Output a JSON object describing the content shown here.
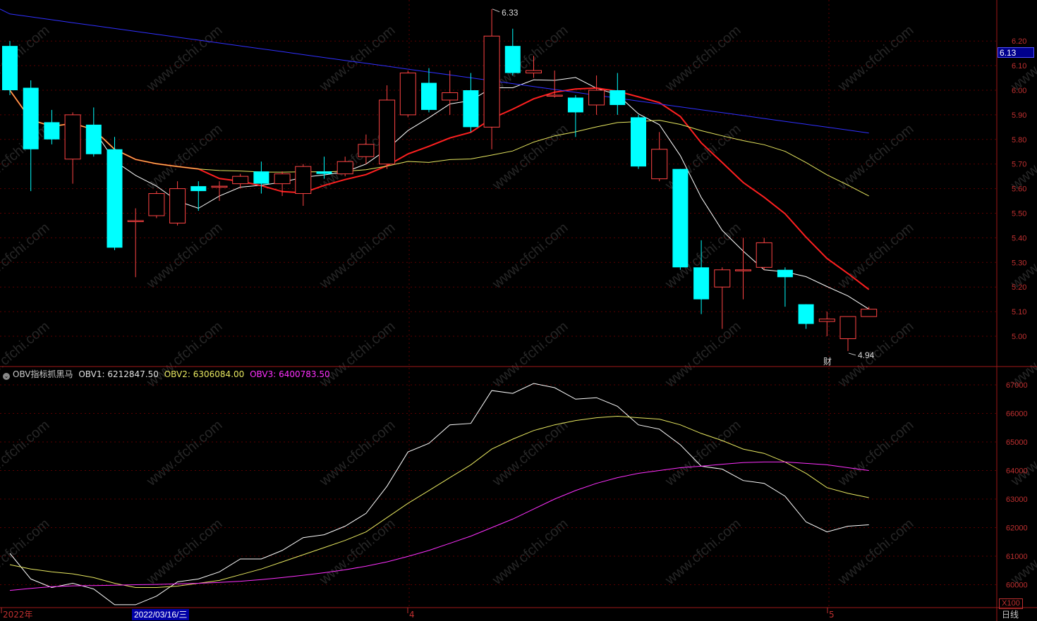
{
  "price_axis": {
    "ticks": [
      "6.20",
      "6.10",
      "6.00",
      "5.90",
      "5.80",
      "5.70",
      "5.60",
      "5.50",
      "5.40",
      "5.30",
      "5.20",
      "5.10",
      "5.00"
    ],
    "current": "6.13"
  },
  "annotations": {
    "high": "6.33",
    "low": "4.94",
    "fin_marker": "财"
  },
  "indicator": {
    "name": "OBV指标抓黑马",
    "obv1_label": "OBV1: 6212847.50",
    "obv2_label": "OBV2: 6306084.00",
    "obv3_label": "OBV3: 6400783.50",
    "ticks": [
      "67000",
      "66000",
      "65000",
      "64000",
      "63000",
      "62000",
      "61000",
      "60000"
    ],
    "scale": "X100"
  },
  "x_axis": {
    "labels": [
      "2022年",
      "4",
      "5"
    ],
    "cursor_date": "2022/03/16/三"
  },
  "period_button": "日线",
  "watermark": "www.cfchi.com",
  "colors": {
    "up": "#ff4444",
    "down": "#00ffff",
    "ma5": "#ffffff",
    "ma10": "#ff2020",
    "ma20": "#e8e860",
    "ma60": "#3030ff",
    "obv1": "#ffffff",
    "obv2": "#e8e860",
    "obv3": "#ff30ff"
  },
  "chart_data": [
    {
      "type": "candlestick",
      "ylim": [
        4.88,
        6.4
      ],
      "candles": [
        [
          6.18,
          6.0,
          6.2,
          5.98
        ],
        [
          6.01,
          5.76,
          6.04,
          5.59
        ],
        [
          5.87,
          5.8,
          5.92,
          5.78
        ],
        [
          5.72,
          5.9,
          5.91,
          5.62
        ],
        [
          5.86,
          5.74,
          5.93,
          5.73
        ],
        [
          5.76,
          5.36,
          5.81,
          5.35
        ],
        [
          5.47,
          5.47,
          5.52,
          5.24
        ],
        [
          5.49,
          5.58,
          5.59,
          5.48
        ],
        [
          5.46,
          5.6,
          5.63,
          5.45
        ],
        [
          5.61,
          5.59,
          5.63,
          5.51
        ],
        [
          5.61,
          5.61,
          5.63,
          5.55
        ],
        [
          5.62,
          5.65,
          5.66,
          5.6
        ],
        [
          5.67,
          5.62,
          5.71,
          5.58
        ],
        [
          5.62,
          5.66,
          5.67,
          5.57
        ],
        [
          5.58,
          5.69,
          5.7,
          5.53
        ],
        [
          5.67,
          5.66,
          5.73,
          5.64
        ],
        [
          5.66,
          5.71,
          5.73,
          5.65
        ],
        [
          5.73,
          5.78,
          5.82,
          5.7
        ],
        [
          5.7,
          5.96,
          6.02,
          5.68
        ],
        [
          5.9,
          6.07,
          6.08,
          5.89
        ],
        [
          6.03,
          5.92,
          6.09,
          5.91
        ],
        [
          5.96,
          5.99,
          6.08,
          5.9
        ],
        [
          6.0,
          5.85,
          6.07,
          5.83
        ],
        [
          5.85,
          6.22,
          6.33,
          5.76
        ],
        [
          6.18,
          6.07,
          6.25,
          6.06
        ],
        [
          6.07,
          6.08,
          6.14,
          6.05
        ],
        [
          5.98,
          5.98,
          6.08,
          5.97
        ],
        [
          5.97,
          5.91,
          5.98,
          5.81
        ],
        [
          5.94,
          6.0,
          6.06,
          5.9
        ],
        [
          6.0,
          5.94,
          6.07,
          5.9
        ],
        [
          5.89,
          5.69,
          5.9,
          5.68
        ],
        [
          5.64,
          5.76,
          5.83,
          5.63
        ],
        [
          5.68,
          5.28,
          5.68,
          5.27
        ],
        [
          5.28,
          5.15,
          5.39,
          5.09
        ],
        [
          5.2,
          5.27,
          5.28,
          5.03
        ],
        [
          5.27,
          5.27,
          5.4,
          5.15
        ],
        [
          5.28,
          5.38,
          5.4,
          5.27
        ],
        [
          5.27,
          5.24,
          5.28,
          5.12
        ],
        [
          5.13,
          5.05,
          5.13,
          5.03
        ],
        [
          5.06,
          5.07,
          5.1,
          5.0
        ],
        [
          4.99,
          5.08,
          5.08,
          4.94
        ],
        [
          5.08,
          5.11,
          5.12,
          5.08
        ]
      ]
    },
    {
      "type": "line",
      "series": [
        {
          "name": "OBV1",
          "values": [
            61100,
            60200,
            59900,
            60050,
            59850,
            59300,
            59300,
            59600,
            60100,
            60200,
            60450,
            60900,
            60900,
            61200,
            61650,
            61750,
            62050,
            62500,
            63450,
            64650,
            64950,
            65600,
            65650,
            66800,
            66700,
            67050,
            66900,
            66500,
            66550,
            66250,
            65600,
            65450,
            64900,
            64150,
            64050,
            63650,
            63550,
            63100,
            62200,
            61850,
            62050,
            62100
          ]
        },
        {
          "name": "OBV2",
          "values": [
            60700,
            60550,
            60450,
            60380,
            60250,
            60050,
            59900,
            59900,
            59950,
            60050,
            60150,
            60350,
            60550,
            60800,
            61050,
            61300,
            61550,
            61850,
            62350,
            62850,
            63300,
            63750,
            64200,
            64750,
            65100,
            65400,
            65600,
            65750,
            65850,
            65900,
            65850,
            65800,
            65600,
            65300,
            65050,
            64750,
            64600,
            64300,
            63900,
            63400,
            63200,
            63050
          ]
        },
        {
          "name": "OBV3",
          "values": [
            59800,
            59870,
            59930,
            59960,
            59970,
            59980,
            60000,
            60010,
            60030,
            60050,
            60080,
            60120,
            60180,
            60250,
            60330,
            60420,
            60520,
            60650,
            60800,
            60990,
            61200,
            61450,
            61700,
            62000,
            62300,
            62650,
            63000,
            63300,
            63550,
            63750,
            63900,
            64000,
            64100,
            64150,
            64220,
            64280,
            64300,
            64300,
            64250,
            64200,
            64100,
            64000
          ]
        }
      ]
    }
  ]
}
